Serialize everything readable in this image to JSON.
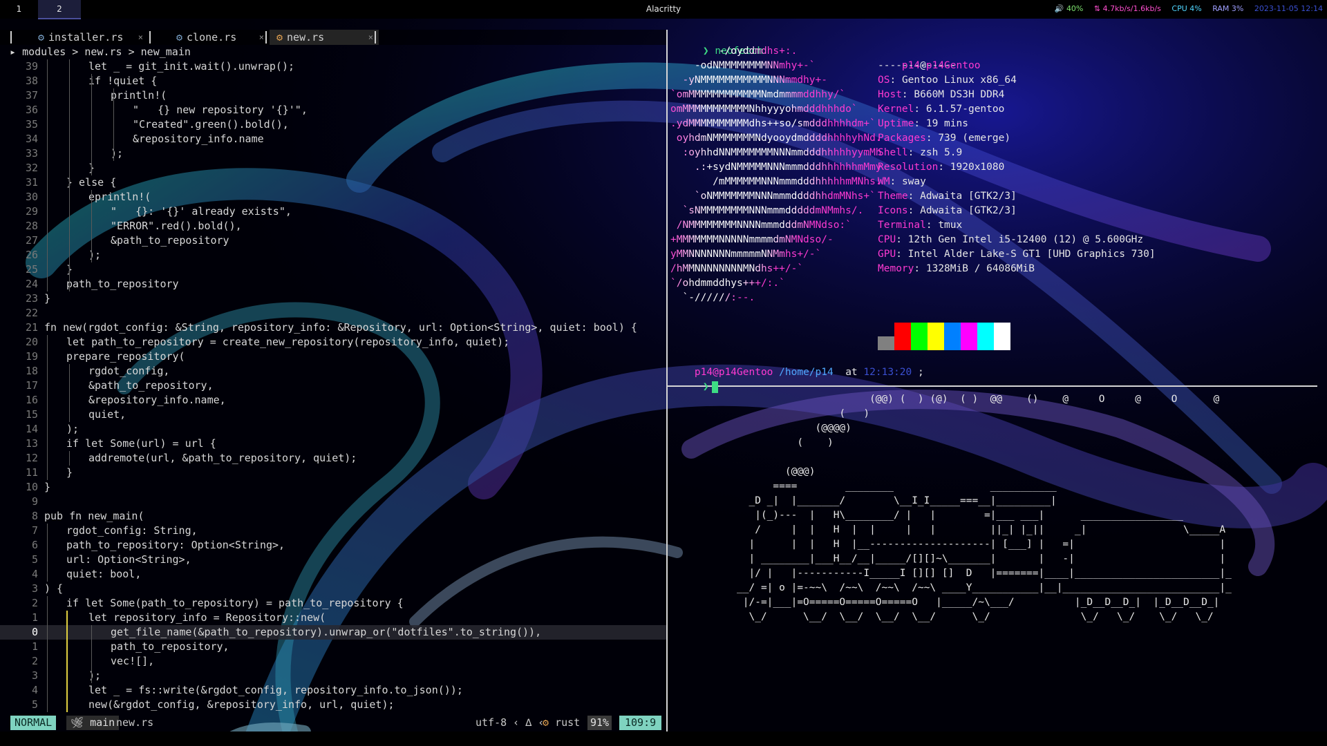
{
  "topbar": {
    "workspaces": [
      "1",
      "2"
    ],
    "active_workspace": "2",
    "window_title": "Alacritty",
    "status": {
      "volume": "40%",
      "net": "4.7kb/s/1.6kb/s",
      "cpu": "CPU 4%",
      "ram": "RAM 3%",
      "datetime": "2023-11-05 12:14"
    }
  },
  "editor": {
    "tabs": [
      {
        "name": "installer.rs",
        "active": false
      },
      {
        "name": "clone.rs",
        "active": false
      },
      {
        "name": "new.rs",
        "active": true
      }
    ],
    "breadcrumb": "modules > new.rs > new_main",
    "lines": [
      {
        "num": "39",
        "indent": 2,
        "code": "let _ = git_init.wait().unwrap();"
      },
      {
        "num": "38",
        "indent": 2,
        "code": "if !quiet {"
      },
      {
        "num": "37",
        "indent": 3,
        "code": "println!("
      },
      {
        "num": "36",
        "indent": 4,
        "code": "\"   {} new repository '{}'\","
      },
      {
        "num": "35",
        "indent": 4,
        "code": "\"Created\".green().bold(),"
      },
      {
        "num": "34",
        "indent": 4,
        "code": "&repository_info.name"
      },
      {
        "num": "33",
        "indent": 3,
        "code": ");"
      },
      {
        "num": "32",
        "indent": 2,
        "code": "}"
      },
      {
        "num": "31",
        "indent": 1,
        "code": "} else {"
      },
      {
        "num": "30",
        "indent": 2,
        "code": "eprintln!("
      },
      {
        "num": "29",
        "indent": 3,
        "code": "\"   {}: '{}' already exists\","
      },
      {
        "num": "28",
        "indent": 3,
        "code": "\"ERROR\".red().bold(),"
      },
      {
        "num": "27",
        "indent": 3,
        "code": "&path_to_repository"
      },
      {
        "num": "26",
        "indent": 2,
        "code": ");"
      },
      {
        "num": "25",
        "indent": 1,
        "code": "}"
      },
      {
        "num": "24",
        "indent": 1,
        "code": "path_to_repository"
      },
      {
        "num": "23",
        "indent": 0,
        "code": "}"
      },
      {
        "num": "22",
        "indent": 0,
        "code": ""
      },
      {
        "num": "21",
        "indent": 0,
        "code": "fn new(rgdot_config: &String, repository_info: &Repository, url: Option<String>, quiet: bool) {"
      },
      {
        "num": "20",
        "indent": 1,
        "code": "let path_to_repository = create_new_repository(repository_info, quiet);"
      },
      {
        "num": "19",
        "indent": 1,
        "code": "prepare_repository("
      },
      {
        "num": "18",
        "indent": 2,
        "code": "rgdot_config,"
      },
      {
        "num": "17",
        "indent": 2,
        "code": "&path_to_repository,"
      },
      {
        "num": "16",
        "indent": 2,
        "code": "&repository_info.name,"
      },
      {
        "num": "15",
        "indent": 2,
        "code": "quiet,"
      },
      {
        "num": "14",
        "indent": 1,
        "code": ");"
      },
      {
        "num": "13",
        "indent": 1,
        "code": "if let Some(url) = url {"
      },
      {
        "num": "12",
        "indent": 2,
        "code": "addremote(url, &path_to_repository, quiet);"
      },
      {
        "num": "11",
        "indent": 1,
        "code": "}"
      },
      {
        "num": "10",
        "indent": 0,
        "code": "}"
      },
      {
        "num": "9",
        "indent": 0,
        "code": ""
      },
      {
        "num": "8",
        "indent": 0,
        "code": "pub fn new_main("
      },
      {
        "num": "7",
        "indent": 1,
        "code": "rgdot_config: String,"
      },
      {
        "num": "6",
        "indent": 1,
        "code": "path_to_repository: Option<String>,"
      },
      {
        "num": "5",
        "indent": 1,
        "code": "url: Option<String>,"
      },
      {
        "num": "4",
        "indent": 1,
        "code": "quiet: bool,"
      },
      {
        "num": "3",
        "indent": 0,
        "code": ") {"
      },
      {
        "num": "2",
        "indent": 1,
        "code": "if let Some(path_to_repository) = path_to_repository {"
      },
      {
        "num": "1",
        "indent": 2,
        "code": "let repository_info = Repository::new("
      },
      {
        "num": "0",
        "indent": 3,
        "code": "get_file_name(&path_to_repository).unwrap_or(\"dotfiles\".to_string()),"
      },
      {
        "num": "1",
        "indent": 3,
        "code": "path_to_repository,"
      },
      {
        "num": "2",
        "indent": 3,
        "code": "vec![],"
      },
      {
        "num": "3",
        "indent": 2,
        "code": ");"
      },
      {
        "num": "4",
        "indent": 2,
        "code": "let _ = fs::write(&rgdot_config, repository_info.to_json());"
      },
      {
        "num": "5",
        "indent": 2,
        "code": "new(&rgdot_config, &repository_info, url, quiet);"
      }
    ],
    "statusline": {
      "mode": "NORMAL",
      "branch": "main",
      "file": "new.rs",
      "encoding": "utf-8",
      "filetype": "rust",
      "percent": "91%",
      "position": "109:9"
    }
  },
  "neofetch": {
    "command": "neofetch",
    "logo": [
      "        -/oyddmdhs+:.",
      "    -odNMMMMMMMMNNmhy+-`",
      "  -yNMMMMMMMMMMMNNNmmdhy+-",
      "`omMMMMMMMMMMMMNmdmmmmddhhy/`",
      "omMMMMMMMMMMMNhhyyyohmdddhhhdo`",
      ".ydMMMMMMMMMMdhs++so/smdddhhhhdm+`",
      " oyhdmNMMMMMMMNdyooydmddddhhhhyhNd.",
      "  :oyhhdNNMMMMMMMNNNmmdddhhhhhyymMh",
      "    .:+sydNMMMMMNNNmmmdddhhhhhhmMmy",
      "       /mMMMMMMNNNmmmdddhhhhhmMNhs:",
      "    `oNMMMMMMMNNNmmmddddhhdmMNhs+`",
      "  `sNMMMMMMMMNNNmmmdddddmNMmhs/.",
      " /NMMMMMMMMNNNNmmmdddmNMNdso:`",
      "+MMMMMMMNNNNNmmmmdmNMNdso/-",
      "yMMNNNNNNNmmmmmNNMmhs+/-`",
      "/hMMNNNNNNNNMNdhs++/-`",
      "`/ohdmmddhys+++/:.`",
      "  `-//////:--."
    ],
    "user": "p14",
    "host": "p14Gentoo",
    "underline": "-------------",
    "info": [
      {
        "key": "OS",
        "value": "Gentoo Linux x86_64"
      },
      {
        "key": "Host",
        "value": "B660M DS3H DDR4"
      },
      {
        "key": "Kernel",
        "value": "6.1.57-gentoo"
      },
      {
        "key": "Uptime",
        "value": "19 mins"
      },
      {
        "key": "Packages",
        "value": "739 (emerge)"
      },
      {
        "key": "Shell",
        "value": "zsh 5.9"
      },
      {
        "key": "Resolution",
        "value": "1920x1080"
      },
      {
        "key": "WM",
        "value": "sway"
      },
      {
        "key": "Theme",
        "value": "Adwaita [GTK2/3]"
      },
      {
        "key": "Icons",
        "value": "Adwaita [GTK2/3]"
      },
      {
        "key": "Terminal",
        "value": "tmux"
      },
      {
        "key": "CPU",
        "value": "12th Gen Intel i5-12400 (12) @ 5.600GHz"
      },
      {
        "key": "GPU",
        "value": "Intel Alder Lake-S GT1 [UHD Graphics 730]"
      },
      {
        "key": "Memory",
        "value": "1328MiB / 64086MiB"
      }
    ],
    "palette": [
      "#808080",
      "#ff0000",
      "#00ff00",
      "#ffff00",
      "#0080ff",
      "#ff00ff",
      "#00ffff",
      "#ffffff"
    ],
    "prompt": {
      "userhost": "p14@p14Gentoo",
      "path": "/home/p14",
      "at": "at",
      "time": "12:13:20",
      "suffix": ";"
    }
  },
  "sl": {
    "lines": [
      "                                 (@@) (  ) (@)  ( )  @@    ()    @     O     @     O      @",
      "                            (   )",
      "                        (@@@@)",
      "                     (    )",
      "",
      "                   (@@@)",
      "                 ====        ________                ___________",
      "             _D _|  |_______/        \\__I_I_____===__|_________|",
      "              |(_)---  |   H\\________/ |   |        =|___ ___|      _________________",
      "              /     |  |   H  |  |     |   |         ||_| |_||     _|                \\_____A",
      "             |      |  |   H  |__--------------------| [___] |   =|                        |",
      "             | ________|___H__/__|_____/[][]~\\_______|       |   -|                        |",
      "             |/ |   |-----------I_____I [][] []  D   |=======|____|________________________|_",
      "           __/ =| o |=-~~\\  /~~\\  /~~\\  /~~\\ ____Y___________|__|__________________________|_",
      "            |/-=|___|=O=====O=====O=====O   |_____/~\\___/          |_D__D__D_|  |_D__D__D_|",
      "             \\_/      \\__/  \\__/  \\__/  \\__/      \\_/               \\_/   \\_/    \\_/   \\_/"
    ]
  }
}
